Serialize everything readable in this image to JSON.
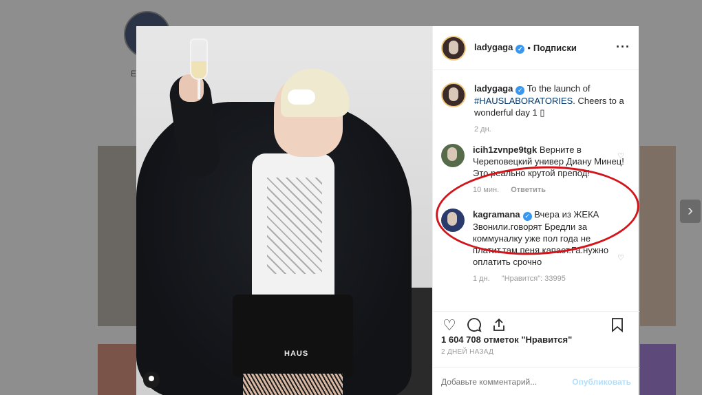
{
  "profile_bg": {
    "initial": "Е"
  },
  "post": {
    "author": "ladygaga",
    "follow_label": "Подписки",
    "more_icon": "more-icon",
    "skirt_text": "HAUS",
    "caption": {
      "user": "ladygaga",
      "text_before": "To the launch of",
      "hashtag": "#HAUSLABORATORIES",
      "text_after": ". Cheers to a wonderful day 1 ",
      "emoji": "▯",
      "time": "2 дн."
    },
    "comments": [
      {
        "user": "icih1zvnpe9tgk",
        "text": "Верните в Череповецкий универ Диану Минец! Это реально крутой препод!",
        "time": "10 мин.",
        "reply": "Ответить"
      },
      {
        "user": "kagramana",
        "text": "Вчера из ЖЕКА Звонили.говорят Бредли за коммуналку уже пол года не платит.там пеня капает.Га.нужно оплатить срочно",
        "time": "1 дн.",
        "likes": "\"Нравится\": 33995"
      }
    ],
    "likes_text": "1 604 708 отметок \"Нравится\"",
    "date": "2 ДНЕЙ НАЗАД",
    "comment_placeholder": "Добавьте комментарий...",
    "publish_label": "Опубликовать"
  },
  "colors": {
    "verified": "#3897f0",
    "highlight_oval": "#d1151b",
    "publish_disabled": "#b2dffc"
  },
  "icons": [
    "heart-icon",
    "comment-icon",
    "share-icon",
    "bookmark-icon",
    "chevron-right-icon",
    "user-tag-icon",
    "verified-badge-icon"
  ]
}
